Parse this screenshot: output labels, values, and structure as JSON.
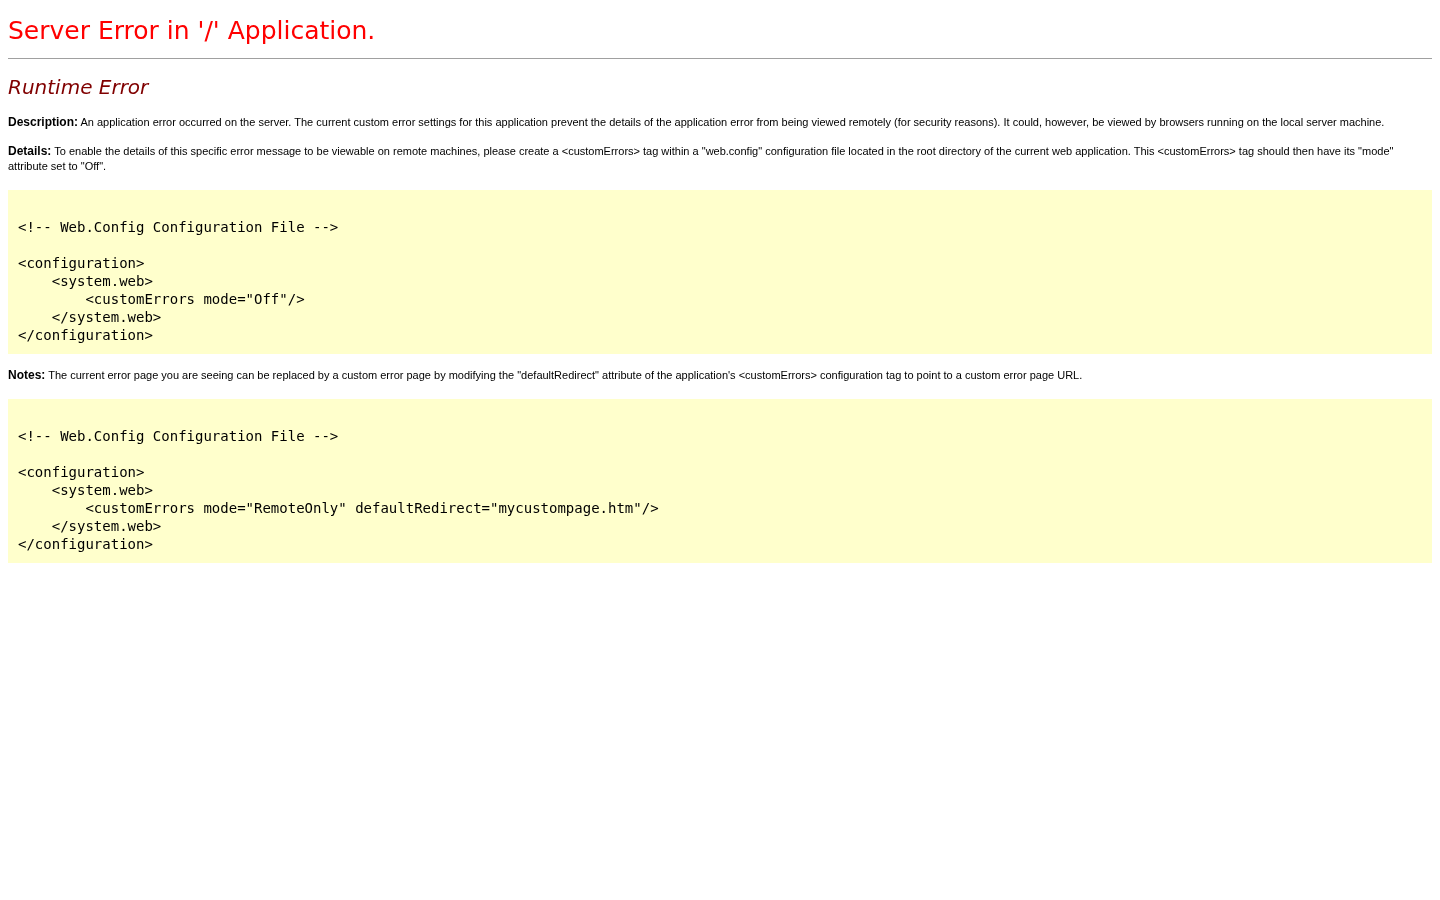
{
  "title": "Server Error in '/' Application.",
  "subtitle": "Runtime Error",
  "blocks": [
    {
      "kind": "paragraph",
      "label": "Description:",
      "text": "An application error occurred on the server. The current custom error settings for this application prevent the details of the application error from being viewed remotely (for security reasons). It could, however, be viewed by browsers running on the local server machine."
    },
    {
      "kind": "paragraph",
      "label": "Details:",
      "text": "To enable the details of this specific error message to be viewable on remote machines, please create a <customErrors> tag within a \"web.config\" configuration file located in the root directory of the current web application. This <customErrors> tag should then have its \"mode\" attribute set to \"Off\"."
    },
    {
      "kind": "code",
      "comment": "<!-- Web.Config Configuration File -->",
      "lines": [
        "<configuration>",
        "    <system.web>",
        "        <customErrors mode=\"Off\"/>",
        "    </system.web>",
        "</configuration>"
      ]
    },
    {
      "kind": "paragraph",
      "label": "Notes:",
      "text": "The current error page you are seeing can be replaced by a custom error page by modifying the \"defaultRedirect\" attribute of the application's <customErrors> configuration tag to point to a custom error page URL."
    },
    {
      "kind": "code",
      "comment": "<!-- Web.Config Configuration File -->",
      "lines": [
        "<configuration>",
        "    <system.web>",
        "        <customErrors mode=\"RemoteOnly\" defaultRedirect=\"mycustompage.htm\"/>",
        "    </system.web>",
        "</configuration>"
      ]
    }
  ]
}
